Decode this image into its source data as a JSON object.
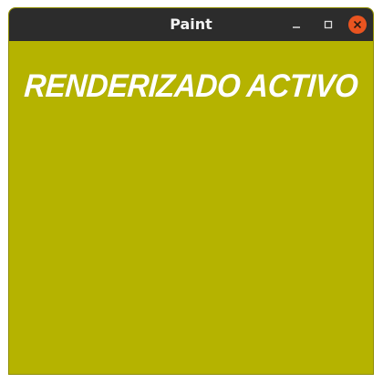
{
  "window": {
    "title": "Paint",
    "controls": {
      "minimize_icon": "minimize-icon",
      "maximize_icon": "maximize-icon",
      "close_icon": "close-icon"
    }
  },
  "canvas": {
    "background": "#b5b300",
    "banner_text": "RENDERIZADO ACTIVO",
    "banner_color": "#ffffff"
  },
  "colors": {
    "titlebar": "#2c2c2c",
    "close_button": "#e95420"
  }
}
